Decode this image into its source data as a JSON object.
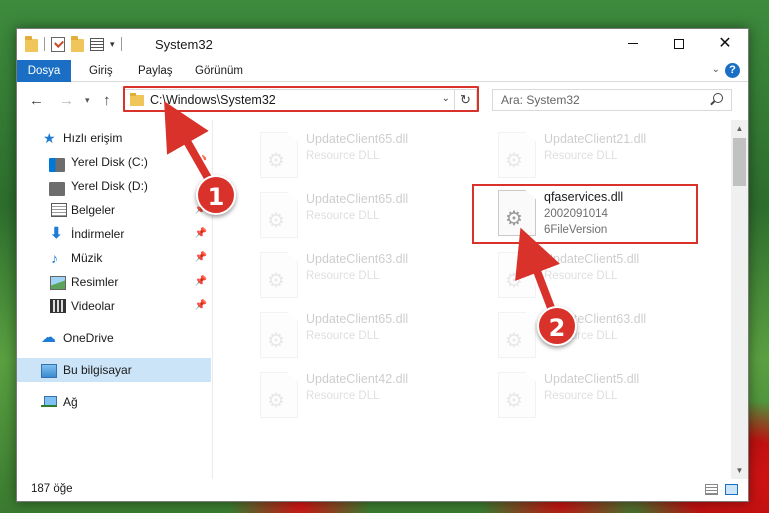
{
  "window": {
    "title": "System32",
    "controls": {
      "minimize": "minimize",
      "maximize": "maximize",
      "close": "close"
    }
  },
  "ribbon": {
    "file_tab": "Dosya",
    "tabs": [
      "Giriş",
      "Paylaş",
      "Görünüm"
    ]
  },
  "address_bar": {
    "path": "C:\\Windows\\System32"
  },
  "search": {
    "placeholder": "Ara: System32"
  },
  "nav_pane": {
    "quick_access": "Hızlı erişim",
    "items": [
      {
        "label": "Yerel Disk (C:)",
        "icon": "disk-icon",
        "pinned": true
      },
      {
        "label": "Yerel Disk (D:)",
        "icon": "disk-icon",
        "pinned": false
      },
      {
        "label": "Belgeler",
        "icon": "documents-icon",
        "pinned": true
      },
      {
        "label": "İndirmeler",
        "icon": "downloads-icon",
        "pinned": true
      },
      {
        "label": "Müzik",
        "icon": "music-icon",
        "pinned": true
      },
      {
        "label": "Resimler",
        "icon": "pictures-icon",
        "pinned": true
      },
      {
        "label": "Videolar",
        "icon": "videos-icon",
        "pinned": true
      }
    ],
    "onedrive": "OneDrive",
    "this_pc": "Bu bilgisayar",
    "network": "Ağ"
  },
  "files": {
    "left_column": [
      {
        "name": "UpdateClient65.dll",
        "desc": "Resource DLL"
      },
      {
        "name": "UpdateClient65.dll",
        "desc": "Resource DLL"
      },
      {
        "name": "UpdateClient63.dll",
        "desc": "Resource DLL"
      },
      {
        "name": "UpdateClient65.dll",
        "desc": "Resource DLL"
      },
      {
        "name": "UpdateClient42.dll",
        "desc": "Resource DLL"
      }
    ],
    "right_column": [
      {
        "name": "UpdateClient21.dll",
        "desc": "Resource DLL"
      },
      {
        "name": "UpdateClient5.dll",
        "desc": "Resource DLL"
      },
      {
        "name": "UpdateClient63.dll",
        "desc": "Resource DLL"
      },
      {
        "name": "UpdateClient5.dll",
        "desc": "Resource DLL"
      }
    ],
    "highlighted": {
      "name": "qfaservices.dll",
      "line1": "2002091014",
      "line2": "6FileVersion"
    }
  },
  "status": {
    "item_count": "187 öğe"
  },
  "annotations": {
    "badge1": "1",
    "badge2": "2",
    "color": "#d9322b"
  }
}
